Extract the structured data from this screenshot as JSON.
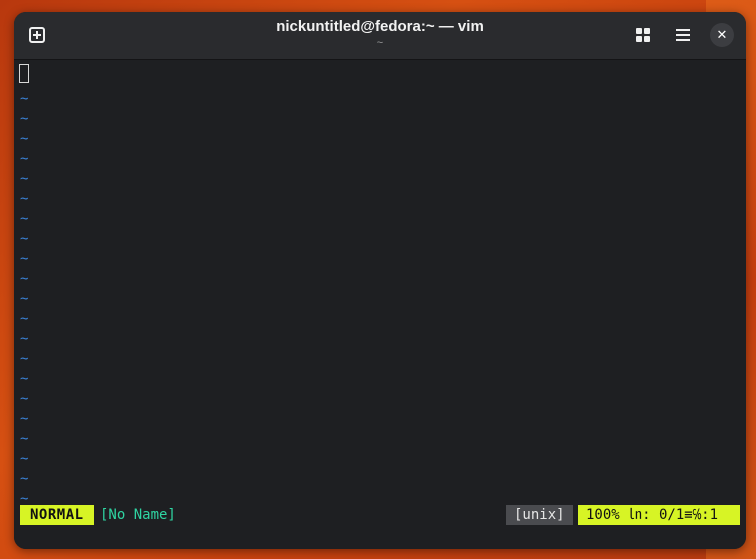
{
  "window": {
    "title": "nickuntitled@fedora:~ — vim",
    "subtitle": "~",
    "icons": [
      "new-tab-icon",
      "grid-icon",
      "menu-icon",
      "close-icon"
    ],
    "close_glyph": "✕"
  },
  "editor": {
    "empty_line_marker": "~",
    "empty_line_count": 21
  },
  "statusline": {
    "mode": "NORMAL",
    "filename": "[No Name]",
    "fileformat": "[unix]",
    "position": "100% ㏑: 0/1≡℅:1"
  },
  "colors": {
    "mode_bg": "#d7f425",
    "filename": "#2fd4a2",
    "tilde": "#3b82d6",
    "terminal_bg": "#1e1f22",
    "headerbar_bg": "#2a2b2e"
  }
}
